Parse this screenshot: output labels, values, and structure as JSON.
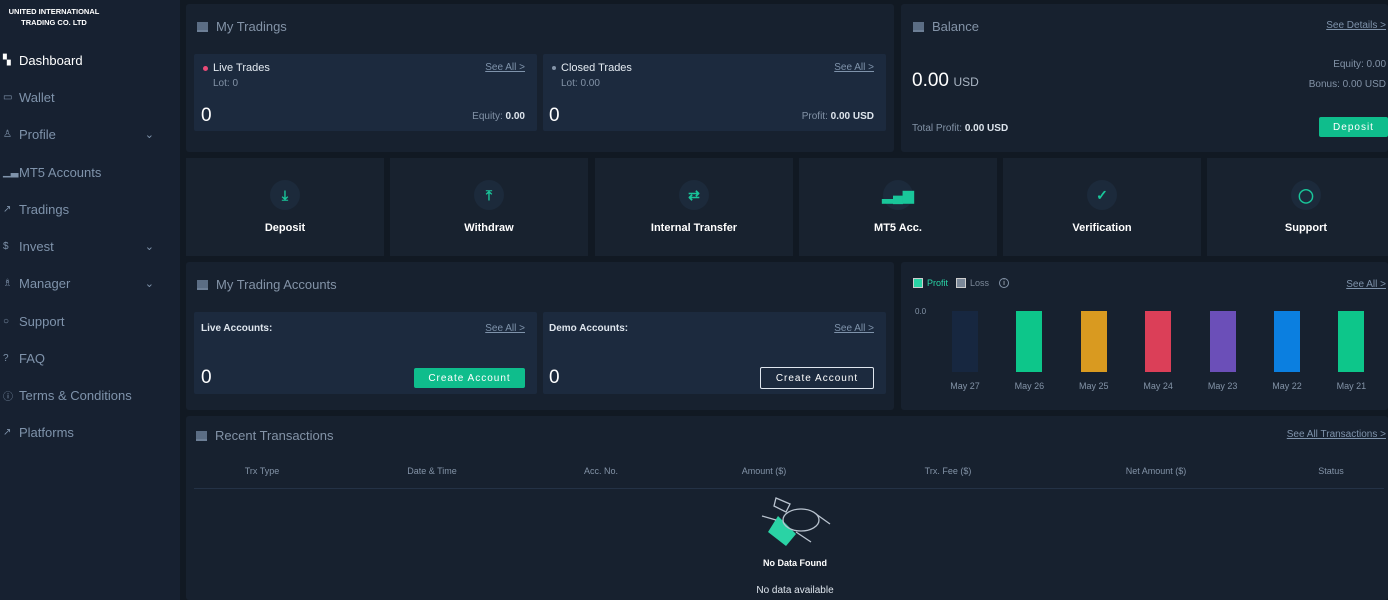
{
  "brand": {
    "line1": "UNITED INTERNATIONAL",
    "line2": "TRADING CO. LTD"
  },
  "sidebar": {
    "items": [
      {
        "label": "Dashboard",
        "icon": "grid-icon",
        "glyph": "▚",
        "active": true
      },
      {
        "label": "Wallet",
        "icon": "wallet-icon",
        "glyph": "▭"
      },
      {
        "label": "Profile",
        "icon": "user-icon",
        "glyph": "♙",
        "chevron": true
      },
      {
        "label": "MT5 Accounts",
        "icon": "bars-icon",
        "glyph": "▁▃",
        "chevron": false
      },
      {
        "label": "Tradings",
        "icon": "trend-icon",
        "glyph": "↗"
      },
      {
        "label": "Invest",
        "icon": "dollar-icon",
        "glyph": "$",
        "chevron": true
      },
      {
        "label": "Manager",
        "icon": "manager-icon",
        "glyph": "♗",
        "chevron": true
      },
      {
        "label": "Support",
        "icon": "chat-icon",
        "glyph": "○"
      },
      {
        "label": "FAQ",
        "icon": "help-icon",
        "glyph": "?"
      },
      {
        "label": "Terms & Conditions",
        "icon": "info-icon",
        "glyph": "ⓘ"
      },
      {
        "label": "Platforms",
        "icon": "trend-icon",
        "glyph": "↗"
      }
    ]
  },
  "my_tradings": {
    "title": "My Tradings",
    "live": {
      "title": "Live Trades",
      "lot": "Lot: 0",
      "count": "0",
      "equity_label": "Equity:",
      "equity": "0.00",
      "see_all": "See All >"
    },
    "closed": {
      "title": "Closed Trades",
      "lot": "Lot: 0.00",
      "count": "0",
      "profit_label": "Profit:",
      "profit": "0.00 USD",
      "see_all": "See All >"
    }
  },
  "balance": {
    "title": "Balance",
    "see_details": "See Details >",
    "amount": "0.00",
    "currency": "USD",
    "equity": "Equity: 0.00",
    "bonus": "Bonus: 0.00 USD",
    "total_profit_label": "Total Profit:",
    "total_profit": "0.00 USD",
    "deposit": "Deposit"
  },
  "quick_actions": [
    {
      "label": "Deposit",
      "glyph": "⤓"
    },
    {
      "label": "Withdraw",
      "glyph": "⤒"
    },
    {
      "label": "Internal Transfer",
      "glyph": "⇄"
    },
    {
      "label": "MT5 Acc.",
      "glyph": "▂▄▆"
    },
    {
      "label": "Verification",
      "glyph": "✓"
    },
    {
      "label": "Support",
      "glyph": "◯"
    }
  ],
  "trading_accounts": {
    "title": "My Trading Accounts",
    "live": {
      "label": "Live Accounts:",
      "see_all": "See All >",
      "count": "0",
      "button": "Create Account"
    },
    "demo": {
      "label": "Demo Accounts:",
      "see_all": "See All >",
      "count": "0",
      "button": "Create Account"
    }
  },
  "chart_data": {
    "type": "bar",
    "legend": [
      "Profit",
      "Loss"
    ],
    "legend_colors": [
      "#2ad3a5",
      "#7b8898"
    ],
    "see_all": "See All >",
    "y_tick": "0.0",
    "categories": [
      "May 27",
      "May 26",
      "May 25",
      "May 24",
      "May 23",
      "May 22",
      "May 21"
    ],
    "values": [
      0,
      0,
      0,
      0,
      0,
      0,
      0
    ],
    "bar_colors": [
      "#172740",
      "#0dc68a",
      "#d99a20",
      "#db3f58",
      "#6b4fb8",
      "#0b7fe0",
      "#0dc68a"
    ]
  },
  "transactions": {
    "title": "Recent Transactions",
    "see_all": "See All Transactions >",
    "columns": [
      "Trx Type",
      "Date & Time",
      "Acc. No.",
      "Amount ($)",
      "Trx. Fee ($)",
      "Net Amount ($)",
      "Status"
    ],
    "empty_caption": "No Data Found",
    "empty": "No data available"
  }
}
